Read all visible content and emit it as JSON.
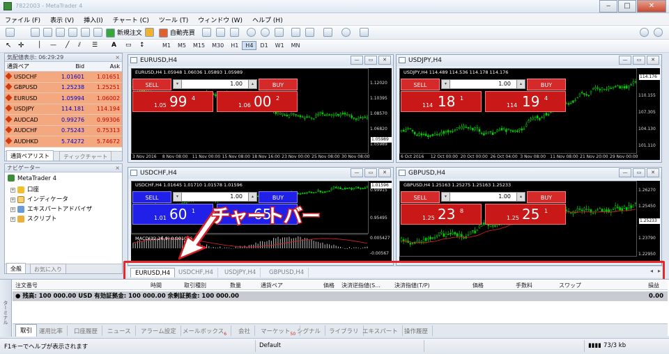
{
  "window": {
    "title": "7822003 - MetaTrader 4"
  },
  "menu": [
    "ファイル (F)",
    "表示 (V)",
    "挿入(I)",
    "チャート (C)",
    "ツール (T)",
    "ウィンドウ (W)",
    "ヘルプ (H)"
  ],
  "toolbar": {
    "new_order": "新規注文",
    "auto_trade": "自動売買",
    "timeframes": [
      "M1",
      "M5",
      "M15",
      "M30",
      "H1",
      "H4",
      "D1",
      "W1",
      "MN"
    ],
    "selected_timeframe": "H4",
    "text_tool": "A"
  },
  "market_watch": {
    "header": "気配値表示: 06:29:29",
    "columns": {
      "symbol": "通貨ペア",
      "bid": "Bid",
      "ask": "Ask"
    },
    "rows": [
      {
        "symbol": "USDCHF",
        "bid": "1.01601",
        "ask": "1.01651"
      },
      {
        "symbol": "GBPUSD",
        "bid": "1.25238",
        "ask": "1.25251"
      },
      {
        "symbol": "EURUSD",
        "bid": "1.05994",
        "ask": "1.06002"
      },
      {
        "symbol": "USDJPY",
        "bid": "114.181",
        "ask": "114.194"
      },
      {
        "symbol": "AUDCAD",
        "bid": "0.99276",
        "ask": "0.99306"
      },
      {
        "symbol": "AUDCHF",
        "bid": "0.75243",
        "ask": "0.75313"
      },
      {
        "symbol": "AUDHKD",
        "bid": "5.74272",
        "ask": "5.74672"
      }
    ],
    "tabs": [
      "通貨ペアリスト",
      "ティックチャート"
    ]
  },
  "navigator": {
    "header": "ナビゲーター",
    "root": "MetaTrader 4",
    "items": [
      "口座",
      "インディケータ",
      "エキスパートアドバイザ",
      "スクリプト"
    ],
    "tabs": [
      "全般",
      "お気に入り"
    ]
  },
  "trade_panel": {
    "sell": "SELL",
    "buy": "BUY",
    "lot": "1.00"
  },
  "charts": [
    {
      "title": "EURUSD,H4",
      "ohlc": "EURUSD,H4  1.05948 1.06036 1.05893 1.05989",
      "sell_small": "1.05",
      "sell_big": "99",
      "sell_sup": "4",
      "buy_small": "1.06",
      "buy_big": "00",
      "buy_sup": "2",
      "price_labels": [
        "1.12020",
        "1.10395",
        "1.08570",
        "1.06820",
        "1.05989"
      ],
      "current_price": "1.05989",
      "x_labels": [
        "3 Nov 2016",
        "8 Nov 08:00",
        "11 Nov 00:00",
        "15 Nov 08:00",
        "18 Nov 16:00",
        "23 Nov 00:00",
        "25 Nov 08:00",
        "30 Nov 08:00"
      ]
    },
    {
      "title": "USDJPY,H4",
      "ohlc": "USDJPY,H4  114.489 114.536 114.178 114.176",
      "sell_small": "114",
      "sell_big": "18",
      "sell_sup": "1",
      "buy_small": "114",
      "buy_big": "19",
      "buy_sup": "4",
      "price_labels": [
        "113.170",
        "110.155",
        "107.305",
        "104.130",
        "101.110"
      ],
      "current_price": "114.176",
      "x_labels": [
        "6 Oct 2016",
        "12 Oct 00:00",
        "20 Oct 00:00",
        "26 Oct 04:00",
        "3 Nov 08:00",
        "11 Nov 08:00",
        "21 Nov 20:00",
        "29 Nov 00:00"
      ]
    },
    {
      "title": "USDCHF,H4",
      "ohlc": "USDCHF,H4  1.01645 1.01710 1.01578 1.01596",
      "sell_small": "1.01",
      "sell_big": "60",
      "sell_sup": "1",
      "buy_small": "",
      "buy_big": "65",
      "buy_sup": "",
      "price_labels": [
        "0.99915",
        "0.95495"
      ],
      "current_price": "1.01596",
      "macd": "MACD(12,26,9)  0.001016",
      "macd_labels": [
        "0.005427",
        "-0.00567"
      ]
    },
    {
      "title": "GBPUSD,H4",
      "ohlc": "GBPUSD,H4  1.25163 1.25275 1.25163 1.25233",
      "sell_small": "1.25",
      "sell_big": "23",
      "sell_sup": "8",
      "buy_small": "1.25",
      "buy_big": "25",
      "buy_sup": "1",
      "price_labels": [
        "1.26270",
        "1.25450",
        "1.24630",
        "1.23790",
        "1.22950"
      ],
      "current_price": "1.25233"
    }
  ],
  "chart_tabs": [
    "EURUSD,H4",
    "USDCHF,H4",
    "USDJPY,H4",
    "GBPUSD,H4"
  ],
  "callout": "チャートバー",
  "terminal": {
    "side_label": "ターミナル",
    "columns": [
      "注文番号",
      "時間",
      "取引種別",
      "数量",
      "通貨ペア",
      "価格",
      "決済逆指値(S...",
      "決済指値(T/P)",
      "価格",
      "手数料",
      "スワップ",
      "損益"
    ],
    "balance_line": "残高: 100 000.00 USD  有効証拠金: 100 000.00  余剰証拠金: 100 000.00",
    "balance_value": "0.00",
    "tabs": [
      "取引",
      "運用比率",
      "口座履歴",
      "ニュース",
      "アラーム設定",
      "メールボックス",
      "会社",
      "マーケット",
      "シグナル",
      "ライブラリ",
      "エキスパート",
      "操作履歴"
    ],
    "mailbox_count": "6",
    "market_count": "50"
  },
  "status": {
    "help": "F1キーでヘルプが表示されます",
    "profile": "Default",
    "traffic": "73/3 kb"
  },
  "colors": {
    "highlight": "#e8272b",
    "row_bg": "#f4a880",
    "candle_up": "#00d000",
    "sell": "#d42a2a",
    "buy_blue": "#2020e8"
  }
}
